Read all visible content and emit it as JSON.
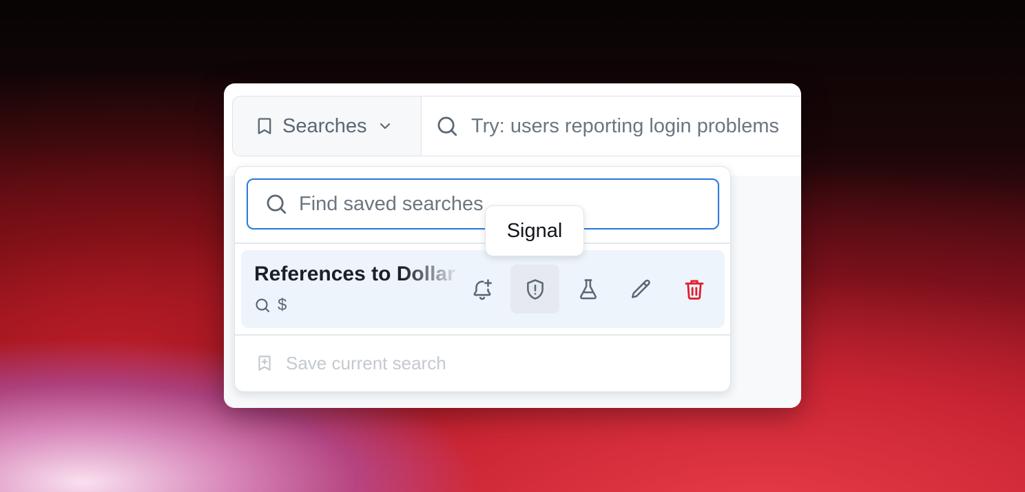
{
  "header": {
    "searches_label": "Searches",
    "main_search_placeholder": "Try: users reporting login problems"
  },
  "dropdown": {
    "find_placeholder": "Find saved searches",
    "saved_searches": [
      {
        "title": "References to Dollar",
        "query": "$",
        "actions": [
          {
            "icon": "bell-plus-icon",
            "label": "Alert"
          },
          {
            "icon": "shield-alert-icon",
            "label": "Signal"
          },
          {
            "icon": "flask-icon",
            "label": "Test"
          },
          {
            "icon": "pencil-icon",
            "label": "Edit"
          },
          {
            "icon": "trash-icon",
            "label": "Delete"
          }
        ]
      }
    ],
    "save_current_label": "Save current search"
  },
  "tooltip": {
    "text": "Signal"
  },
  "colors": {
    "accent": "#2f7ad8",
    "danger": "#e11d2e",
    "muted_text": "#5c6773",
    "disabled_text": "#c4c9cf",
    "row_highlight": "#eef4fb"
  }
}
